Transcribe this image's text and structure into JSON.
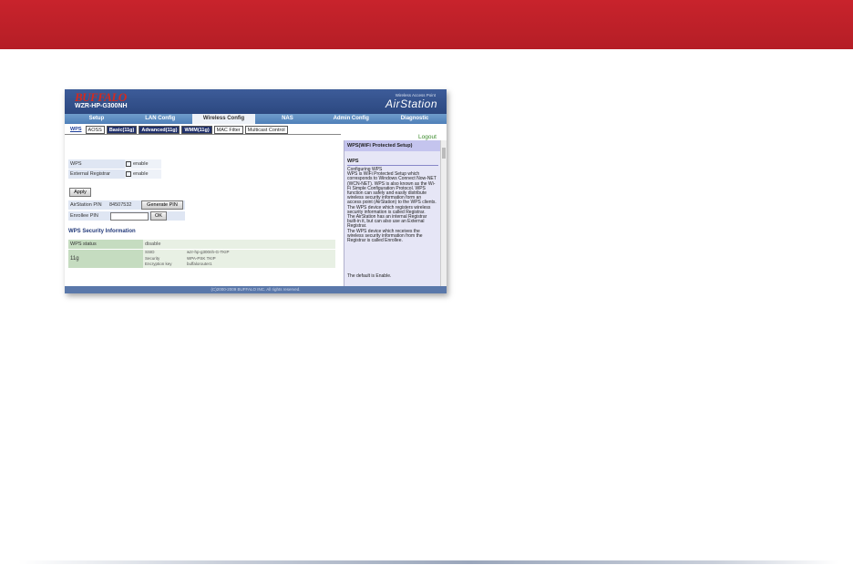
{
  "router": {
    "brand": "BUFFALO",
    "model": "WZR-HP-G300NH",
    "product_line": "Wireless Access Point",
    "product": "AirStation"
  },
  "menu": [
    "Setup",
    "LAN Config",
    "Wireless Config",
    "NAS",
    "Admin Config",
    "Diagnostic"
  ],
  "subtabs": [
    "WPS",
    "AOSS",
    "Basic(11g)",
    "Advanced(11g)",
    "WMM(11g)",
    "MAC Filter",
    "Multicast Control"
  ],
  "logout": "Logout",
  "form": {
    "wps_label": "WPS",
    "wps_value": "enable",
    "ext_reg_label": "External Registrar",
    "ext_reg_value": "enable",
    "apply": "Apply",
    "pin_label": "AirStation PIN",
    "pin_value": "84507532",
    "generate_pin": "Generate PIN",
    "enrollee_label": "Enrollee PIN",
    "ok": "OK"
  },
  "security": {
    "title": "WPS Security Information",
    "status_label": "WPS status",
    "status_value": "disable",
    "band": "11g",
    "ssid_label": "SSID",
    "ssid_value": "wzr-hp-g300nh-G-TKIP",
    "security_label": "Security",
    "security_value": "WPA-PSK TKIP",
    "key_label": "Encryption key",
    "key_value": "buffalorouter1"
  },
  "help": {
    "title": "WPS(WiFi Protected Setup)",
    "heading": "WPS",
    "body": "Configuring WPS\nWPS is WiFi Protected Setup which corresponds to Windows Connect Now-NET (WCN-NET). WPS is also known as the Wi-Fi Simple Configuration Protocol. WPS function can safely and easily distribute wireless security information form an access point (AirStation) to the WPS clients.\nThe WPS device which registers wireless security information is called Registrar.\nThe AirStation has an internal Registrar built-in it, but can also use an External Registrar.\nThe WPS device which receives the wireless security information from the Registrar is called Enrollee.",
    "default": "The default is Enable."
  },
  "footer": "(C)2000-2009 BUFFALO INC. All rights reserved.",
  "colors": {
    "banner": "#c8232c",
    "router_header": "#2c4880"
  }
}
